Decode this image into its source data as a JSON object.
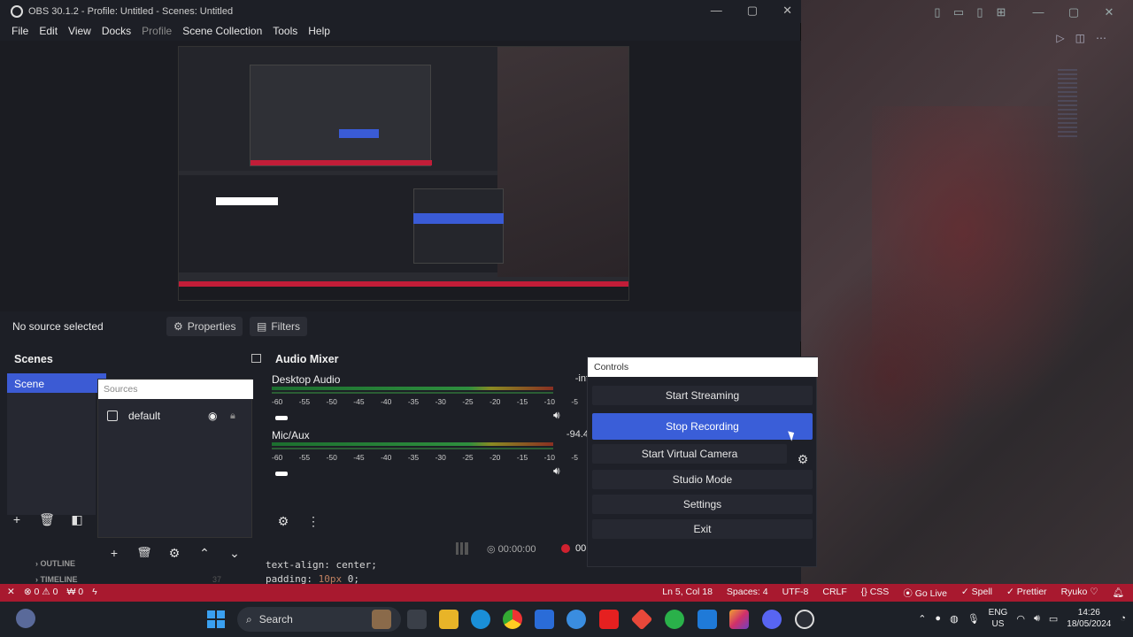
{
  "window": {
    "title": "OBS 30.1.2 - Profile: Untitled - Scenes: Untitled",
    "controls": [
      "—",
      "▢",
      "✕"
    ]
  },
  "menu": [
    "File",
    "Edit",
    "View",
    "Docks",
    "Profile",
    "Scene Collection",
    "Tools",
    "Help"
  ],
  "source_bar": {
    "no_source": "No source selected",
    "properties": "Properties",
    "filters": "Filters"
  },
  "scenes": {
    "title": "Scenes",
    "items": [
      "Scene"
    ]
  },
  "sources": {
    "header": "Sources",
    "items": [
      "default"
    ]
  },
  "mixer": {
    "title": "Audio Mixer",
    "tracks": [
      {
        "name": "Desktop Audio",
        "level": "-inf"
      },
      {
        "name": "Mic/Aux",
        "level": "-94.4"
      }
    ],
    "scale": [
      "-60",
      "-55",
      "-50",
      "-45",
      "-40",
      "-35",
      "-30",
      "-25",
      "-20",
      "-15",
      "-10",
      "-5"
    ]
  },
  "status": {
    "stream_time": "00:00:00",
    "rec_time": "00"
  },
  "controls": {
    "header": "Controls",
    "start_streaming": "Start Streaming",
    "stop_recording": "Stop Recording",
    "start_virtual_camera": "Start Virtual Camera",
    "studio_mode": "Studio Mode",
    "settings": "Settings",
    "exit": "Exit"
  },
  "code": {
    "outline": "OUTLINE",
    "timeline": "TIMELINE",
    "line_no": "37",
    "line1": "text-align: center;",
    "line2_prop": "padding: ",
    "line2_num": "10",
    "line2_unit": "px",
    "line2_end": " 0;"
  },
  "vscode_status": {
    "errors": "⊗ 0 ⚠ 0",
    "ports": "₩ 0",
    "position": "Ln 5, Col 18",
    "spaces": "Spaces: 4",
    "encoding": "UTF-8",
    "eol": "CRLF",
    "language": "{} CSS",
    "golive": "⦿ Go Live",
    "spell": "✓ Spell",
    "prettier": "✓ Prettier",
    "theme": "Ryuko ♡"
  },
  "taskbar": {
    "search": "Search",
    "lang_top": "ENG",
    "lang_bottom": "US",
    "time": "14:26",
    "date": "18/05/2024"
  },
  "colors": {
    "accent": "#3a5ed8",
    "status_red": "#a8192f",
    "panel": "#1d1f26"
  }
}
